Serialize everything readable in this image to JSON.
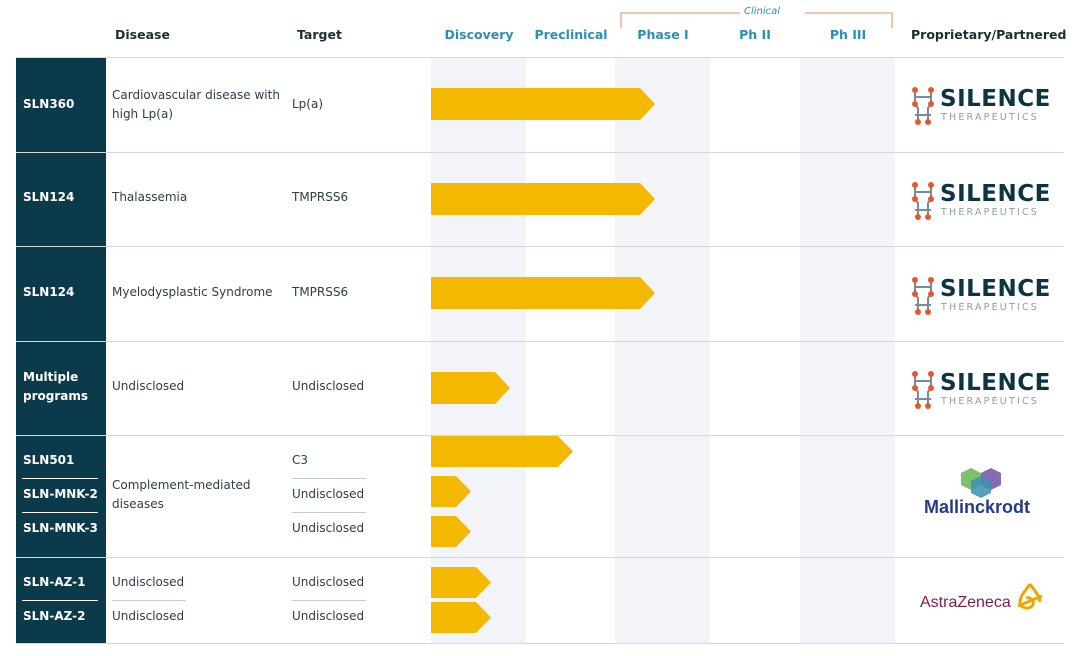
{
  "headers": {
    "disease": "Disease",
    "target": "Target",
    "discovery": "Discovery",
    "preclinical": "Preclinical",
    "phase1": "Phase I",
    "ph2": "Ph II",
    "ph3": "Ph III",
    "clinical": "Clinical",
    "partner": "Proprietary/Partnered"
  },
  "rows": [
    {
      "code": "SLN360",
      "disease": [
        "Cardiovascular disease with",
        "high Lp(a)"
      ],
      "target": "Lp(a)",
      "stage": "Phase I",
      "partner": "Silence Therapeutics"
    },
    {
      "code": "SLN124",
      "disease": [
        "Thalassemia"
      ],
      "target": "TMPRSS6",
      "stage": "Phase I",
      "partner": "Silence Therapeutics"
    },
    {
      "code": "SLN124",
      "disease": [
        "Myelodysplastic Syndrome"
      ],
      "target": "TMPRSS6",
      "stage": "Phase I",
      "partner": "Silence Therapeutics"
    },
    {
      "code": [
        "Multiple",
        "programs"
      ],
      "disease": [
        "Undisclosed"
      ],
      "target": "Undisclosed",
      "stage": "Discovery",
      "partner": "Silence Therapeutics"
    }
  ],
  "mallinckrodt_group": {
    "codes": [
      "SLN501",
      "SLN-MNK-2",
      "SLN-MNK-3"
    ],
    "disease": [
      "Complement-mediated",
      "diseases"
    ],
    "targets": [
      "C3",
      "Undisclosed",
      "Undisclosed"
    ],
    "partner": "Mallinckrodt"
  },
  "astrazeneca_group": {
    "codes": [
      "SLN-AZ-1",
      "SLN-AZ-2"
    ],
    "diseases": [
      "Undisclosed",
      "Undisclosed"
    ],
    "targets": [
      "Undisclosed",
      "Undisclosed"
    ],
    "partner": "AstraZeneca"
  },
  "logos": {
    "silence_word": "SILENCE",
    "silence_sub": "THERAPEUTICS",
    "mallinckrodt": "Mallinckrodt",
    "astrazeneca": "AstraZeneca"
  },
  "colors": {
    "code_column": "#0b3a4a",
    "bar": "#f5b800",
    "stage_header": "#2a8fb8",
    "clinical_bracket": "#f0a080",
    "shade": "#f3f4f8"
  }
}
